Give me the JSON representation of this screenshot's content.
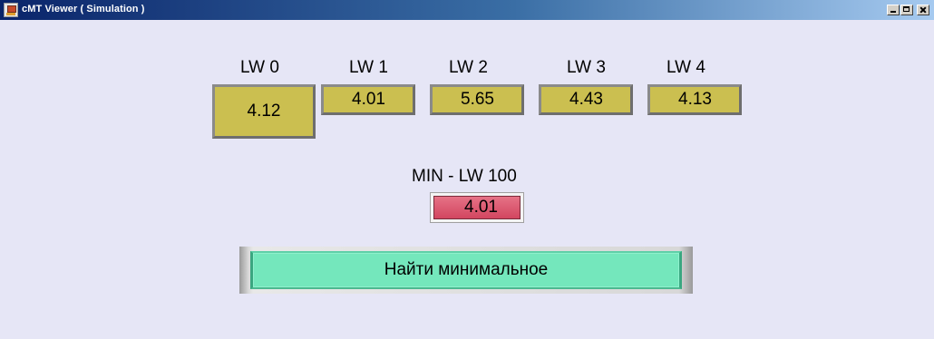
{
  "window": {
    "title": "cMT Viewer ( Simulation )",
    "app_icon": "cmt-viewer-icon",
    "controls": [
      "minimize-icon",
      "maximize-icon",
      "close-icon"
    ]
  },
  "registers": [
    {
      "label": "LW 0",
      "value": "4.12"
    },
    {
      "label": "LW 1",
      "value": "4.01"
    },
    {
      "label": "LW 2",
      "value": "5.65"
    },
    {
      "label": "LW 3",
      "value": "4.43"
    },
    {
      "label": "LW 4",
      "value": "4.13"
    }
  ],
  "min_result": {
    "label": "MIN - LW 100",
    "value": "4.01"
  },
  "action_button": {
    "label": "Найти минимальное"
  },
  "colors": {
    "background": "#e6e6f6",
    "register_fill": "#cbbf50",
    "min_fill": "#d24660",
    "button_fill": "#74e7bc",
    "titlebar_start": "#0a246a"
  }
}
